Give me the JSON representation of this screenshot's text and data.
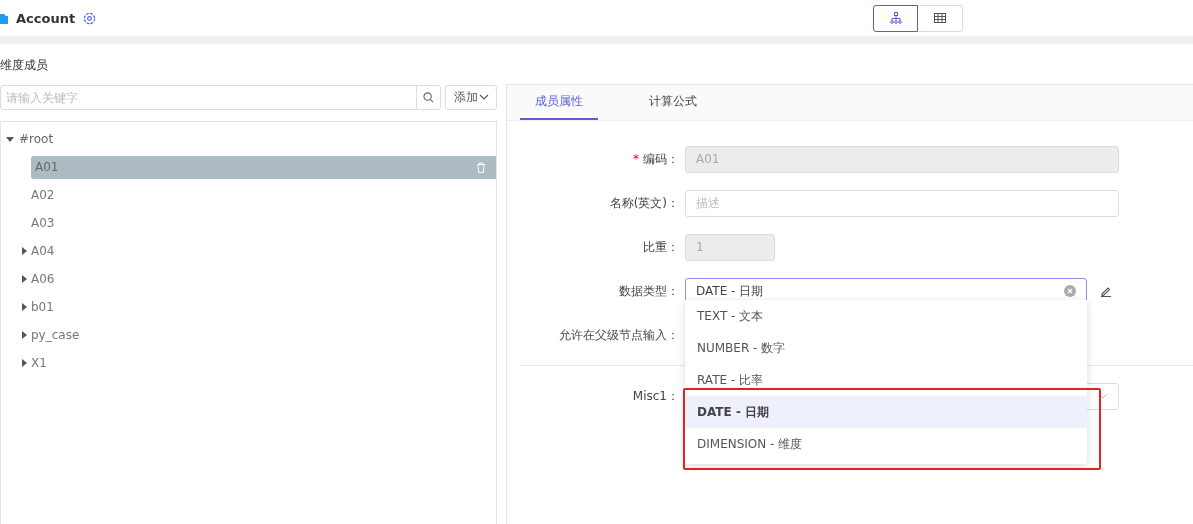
{
  "header": {
    "title": "Account",
    "view_toggle": [
      {
        "kind": "tree",
        "selected": true
      },
      {
        "kind": "table",
        "selected": false
      }
    ]
  },
  "members": {
    "title": "维度成员",
    "search": {
      "placeholder": "请输入关键字"
    },
    "add_button": "添加",
    "tree": [
      {
        "label": "#root",
        "kind": "branch",
        "expanded": true,
        "selected": false,
        "children": [
          {
            "label": "A01",
            "kind": "leaf",
            "selected": true
          },
          {
            "label": "A02",
            "kind": "leaf",
            "selected": false
          },
          {
            "label": "A03",
            "kind": "leaf",
            "selected": false
          },
          {
            "label": "A04",
            "kind": "branch",
            "expanded": false,
            "selected": false
          },
          {
            "label": "A06",
            "kind": "branch",
            "expanded": false,
            "selected": false
          },
          {
            "label": "b01",
            "kind": "branch",
            "expanded": false,
            "selected": false
          },
          {
            "label": "py_case",
            "kind": "branch",
            "expanded": false,
            "selected": false
          },
          {
            "label": "X1",
            "kind": "branch",
            "expanded": false,
            "selected": false
          }
        ]
      }
    ]
  },
  "tabs": [
    {
      "label": "成员属性",
      "selected": true
    },
    {
      "label": "计算公式",
      "selected": false
    }
  ],
  "form": [
    {
      "kind": "text",
      "marker": "*",
      "label": "编码：",
      "value": "A01",
      "disabled": true
    },
    {
      "kind": "text",
      "label": "名称(英文)：",
      "placeholder": "描述",
      "disabled": false
    },
    {
      "kind": "number",
      "label": "比重：",
      "value": "1",
      "disabled": true
    },
    {
      "kind": "select",
      "label": "数据类型：",
      "value": "DATE - 日期",
      "disabled": false
    },
    {
      "kind": "hidden",
      "label": "允许在父级节点输入："
    }
  ],
  "misc": [
    {
      "kind": "select",
      "label": "Misc1："
    }
  ],
  "dropdown": [
    {
      "label": "TEXT - 文本",
      "selected": false
    },
    {
      "label": "NUMBER - 数字",
      "selected": false
    },
    {
      "label": "RATE - 比率",
      "selected": false
    },
    {
      "label": "DATE - 日期",
      "selected": true
    },
    {
      "label": "DIMENSION - 维度",
      "selected": false
    }
  ]
}
